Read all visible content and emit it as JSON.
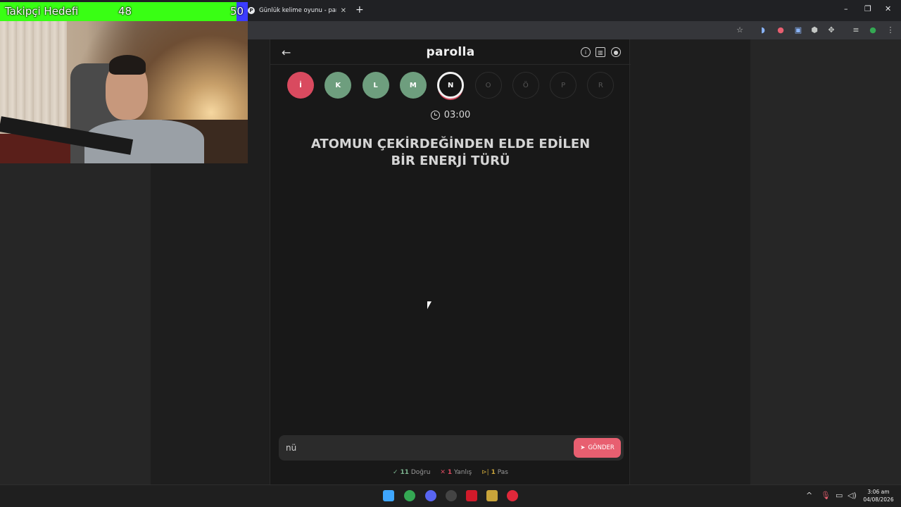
{
  "browser": {
    "tab_title": "Günlük kelime oyunu - parolla",
    "tab_favicon": "P",
    "new_tab": "+",
    "window_controls": [
      "–",
      "❐",
      "✕"
    ]
  },
  "overlay": {
    "follow_goal_label": "Takipçi Hedefi",
    "follow_current": "48",
    "follow_target": "50",
    "fill_color": "#39ff14"
  },
  "app": {
    "brand": "parolla",
    "back_icon": "arrow-left-icon",
    "header_icons": [
      "info-icon",
      "stats-icon",
      "user-icon"
    ],
    "letters": [
      {
        "char": "İ",
        "state": "wrong"
      },
      {
        "char": "K",
        "state": "correct"
      },
      {
        "char": "L",
        "state": "correct"
      },
      {
        "char": "M",
        "state": "correct"
      },
      {
        "char": "N",
        "state": "active"
      },
      {
        "char": "O",
        "state": "pending"
      },
      {
        "char": "Ö",
        "state": "pending"
      },
      {
        "char": "P",
        "state": "pending"
      },
      {
        "char": "R",
        "state": "pending"
      }
    ],
    "timer": "03:00",
    "question_line1": "ATOMUN ÇEKİRDEĞİNDEN ELDE EDİLEN",
    "question_line2": "BİR ENERJİ TÜRÜ",
    "answer_value": "nü",
    "send_label": "GÖNDER",
    "stats": {
      "correct_count": "11",
      "correct_label": "Doğru",
      "wrong_count": "1",
      "wrong_label": "Yanlış",
      "pass_count": "1",
      "pass_label": "Pas"
    },
    "colors": {
      "wrong": "#d94a5f",
      "correct": "#6e9e7e",
      "send": "#e85f70"
    }
  },
  "taskbar": {
    "time": "3:06 am",
    "date": "04/08/2026"
  }
}
